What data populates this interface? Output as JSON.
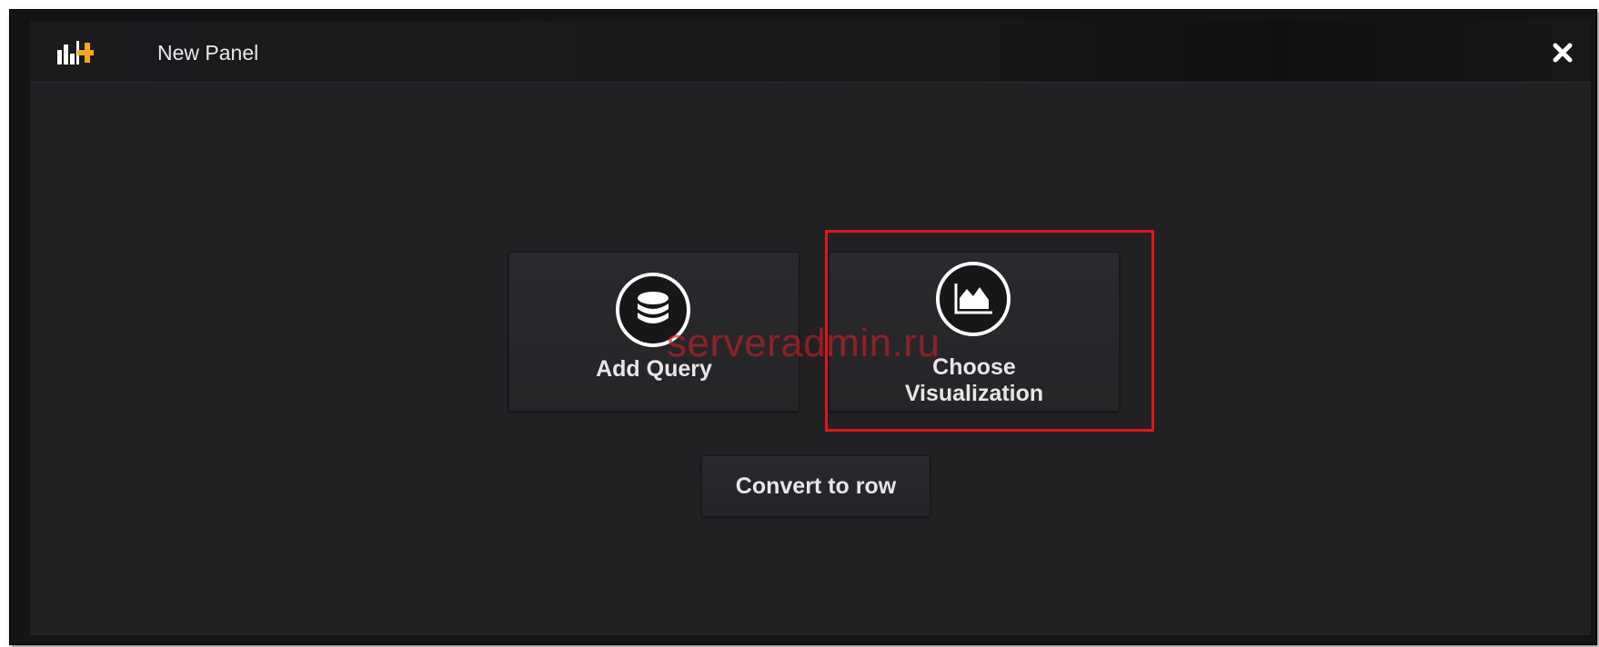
{
  "panel": {
    "title": "New Panel",
    "icon": "panel-add-icon",
    "close_icon": "close-icon"
  },
  "actions": {
    "add_query": {
      "label": "Add Query",
      "icon": "database-icon"
    },
    "choose_visualization": {
      "label_line1": "Choose",
      "label_line2": "Visualization",
      "icon": "area-chart-icon"
    },
    "convert_to_row": {
      "label": "Convert to row"
    }
  },
  "watermark": "serveradmin.ru",
  "colors": {
    "background": "#212124",
    "header": "#1b1b1e",
    "accent_orange": "#f5a623",
    "highlight": "#e0161c",
    "watermark": "#cc1f24"
  }
}
